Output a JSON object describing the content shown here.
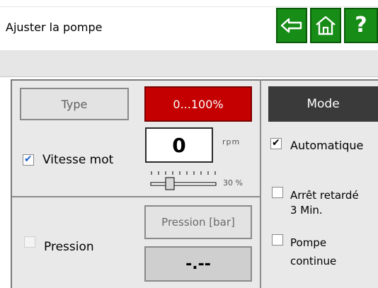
{
  "header": {
    "title": "Ajuster la pompe",
    "accent_color": "#178c17",
    "icons": [
      "back-arrow-icon",
      "home-icon",
      "help-icon"
    ],
    "help_label": "?"
  },
  "pump": {
    "type_label": "Type",
    "range_label": "0...100%",
    "range_color": "#c40000",
    "speed": {
      "enabled": true,
      "label": "Vitesse mot",
      "value": "0",
      "unit": "rpm",
      "slider_value": "30",
      "slider_unit": "%"
    },
    "pressure": {
      "enabled": false,
      "label": "Pression",
      "field_label": "Pression [bar]",
      "value": "-.--"
    }
  },
  "mode": {
    "label": "Mode",
    "options": [
      {
        "label": "Automatique",
        "checked": true
      },
      {
        "label_line1": "Arrêt retardé",
        "label_line2": "3 Min.",
        "checked": false
      },
      {
        "label_line1": "Pompe",
        "label_line2": "continue",
        "checked": false
      }
    ]
  }
}
